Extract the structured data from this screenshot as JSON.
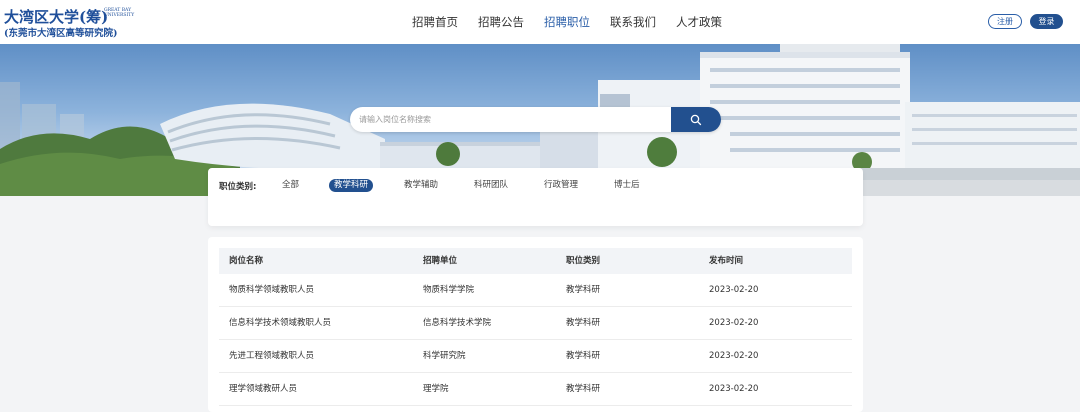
{
  "logo": {
    "main": "大湾区大学(筹)",
    "en_line1": "GREAT BAY",
    "en_line2": "UNIVERSITY",
    "sub": "(东莞市大湾区高等研究院)"
  },
  "nav": {
    "items": [
      "招聘首页",
      "招聘公告",
      "招聘职位",
      "联系我们",
      "人才政策"
    ],
    "active_index": 2
  },
  "auth": {
    "register": "注册",
    "login": "登录"
  },
  "search": {
    "placeholder": "请输入岗位名称搜索",
    "value": ""
  },
  "filter": {
    "label": "职位类别:",
    "options": [
      "全部",
      "教学科研",
      "教学辅助",
      "科研团队",
      "行政管理",
      "博士后"
    ],
    "active_index": 1
  },
  "table": {
    "headers": [
      "岗位名称",
      "招聘单位",
      "职位类别",
      "发布时间"
    ],
    "rows": [
      [
        "物质科学领域教职人员",
        "物质科学学院",
        "教学科研",
        "2023-02-20"
      ],
      [
        "信息科学技术领域教职人员",
        "信息科学技术学院",
        "教学科研",
        "2023-02-20"
      ],
      [
        "先进工程领域教职人员",
        "科学研究院",
        "教学科研",
        "2023-02-20"
      ],
      [
        "理学领域教研人员",
        "理学院",
        "教学科研",
        "2023-02-20"
      ]
    ]
  },
  "colors": {
    "primary": "#22508f",
    "accent_text": "#2a5ea8",
    "page_bg": "#f3f4f6"
  },
  "icons": {
    "search": "search-icon"
  }
}
